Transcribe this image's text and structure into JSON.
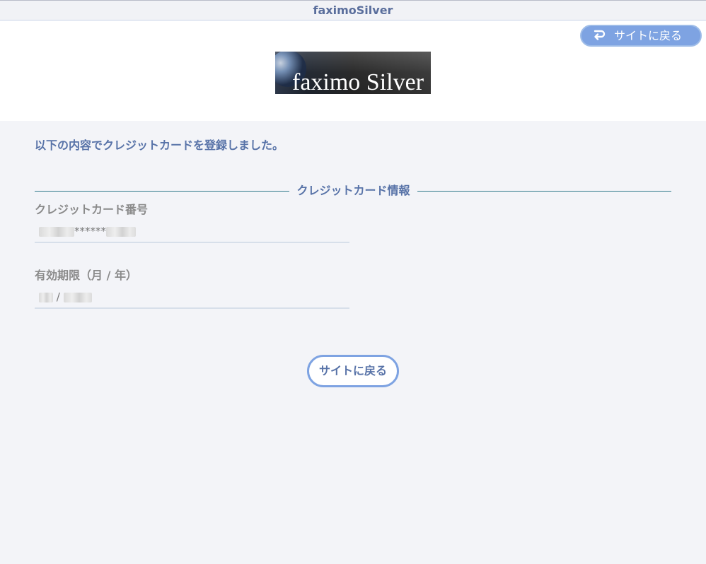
{
  "window": {
    "title": "faximoSilver"
  },
  "header": {
    "back_button_label": "サイトに戻る",
    "logo_text": "faximo Silver"
  },
  "main": {
    "message": "以下の内容でクレジットカードを登録しました。",
    "section_title": "クレジットカード情報",
    "card_number": {
      "label": "クレジットカード番号",
      "masked_middle": "******"
    },
    "expiry": {
      "label": "有効期限（月 / 年）",
      "separator": "/"
    },
    "back_button_label": "サイトに戻る"
  },
  "colors": {
    "accent": "#5873a8",
    "button_fill": "#7ea3e2",
    "section_line": "#2f7a8a"
  }
}
